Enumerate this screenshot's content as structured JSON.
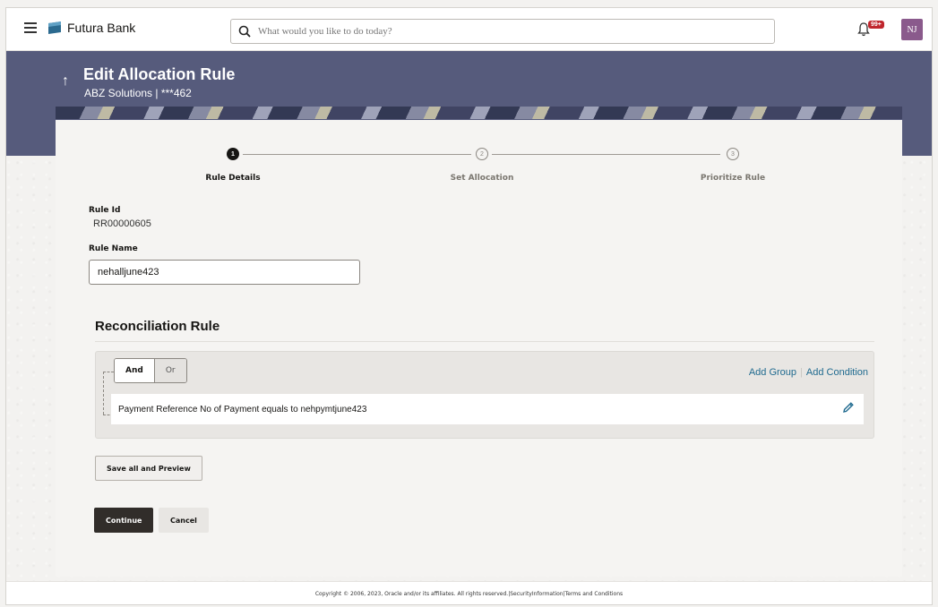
{
  "topbar": {
    "brand_name": "Futura Bank",
    "search_placeholder": "What would you like to do today?",
    "notification_badge": "99+",
    "avatar_initials": "NJ"
  },
  "header": {
    "title": "Edit Allocation Rule",
    "subtitle": "ABZ Solutions | ***462"
  },
  "stepper": {
    "steps": [
      {
        "number": "1",
        "label": "Rule Details",
        "state": "active"
      },
      {
        "number": "2",
        "label": "Set Allocation",
        "state": "pending"
      },
      {
        "number": "3",
        "label": "Prioritize Rule",
        "state": "pending"
      }
    ]
  },
  "form": {
    "rule_id_label": "Rule Id",
    "rule_id_value": "RR00000605",
    "rule_name_label": "Rule Name",
    "rule_name_value": "nehalljune423"
  },
  "reconciliation": {
    "title": "Reconciliation Rule",
    "and_label": "And",
    "or_label": "Or",
    "add_group_label": "Add Group",
    "add_condition_label": "Add Condition",
    "condition_text": "Payment Reference No of Payment equals to nehpymtjune423"
  },
  "actions": {
    "save_preview_label": "Save all and Preview",
    "continue_label": "Continue",
    "cancel_label": "Cancel"
  },
  "footer": {
    "copyright": "Copyright © 2006, 2023, Oracle and/or its affiliates. All rights reserved.|SecurityInformation|Terms and Conditions"
  },
  "colors": {
    "banner": "#565b7c",
    "primary_button": "#312d2a",
    "link": "#1f6a8f",
    "badge": "#c0262d",
    "avatar": "#8a5a8c"
  },
  "icons": [
    "hamburger-icon",
    "bank-logo-icon",
    "search-icon",
    "bell-icon",
    "back-arrow-icon",
    "edit-pencil-icon"
  ]
}
